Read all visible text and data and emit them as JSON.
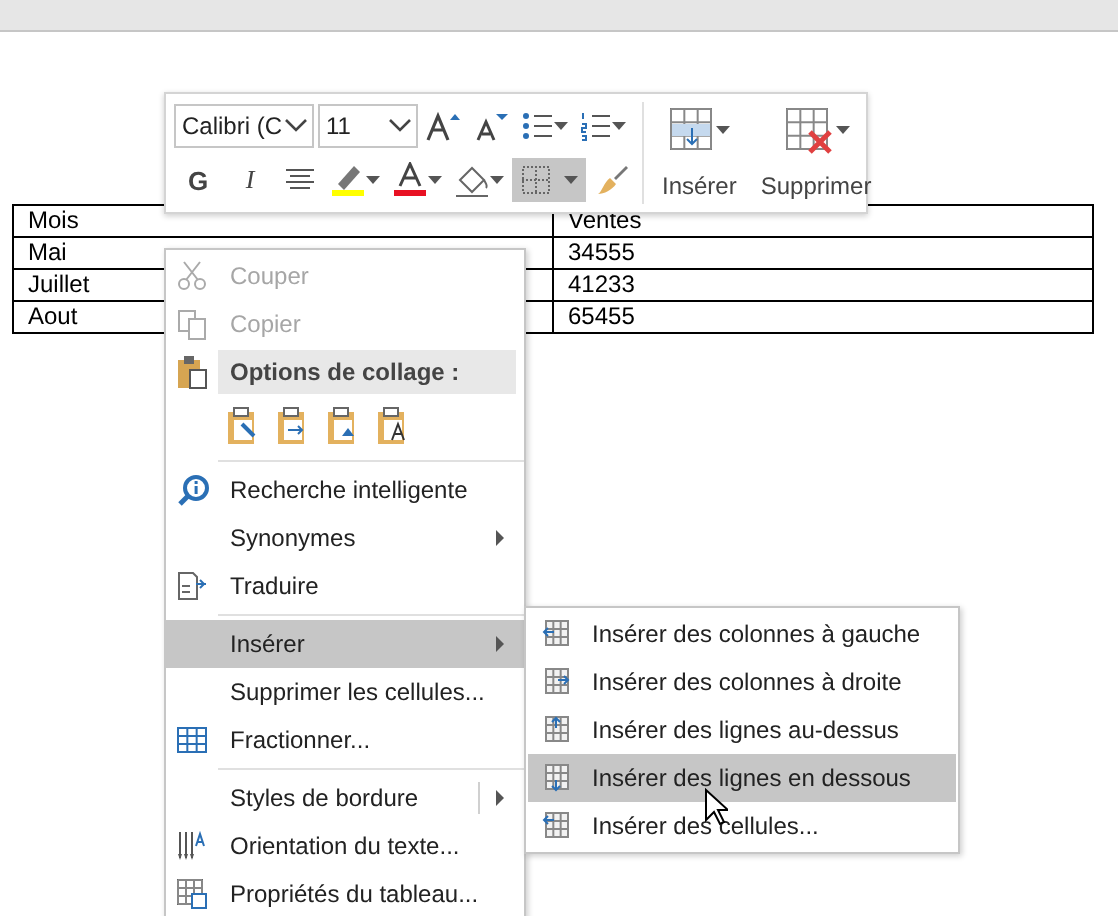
{
  "document": {
    "table": {
      "rows": [
        [
          "Mois",
          "Ventes"
        ],
        [
          "Mai",
          "34555"
        ],
        [
          "Juillet",
          "41233"
        ],
        [
          "Aout",
          "65455"
        ]
      ]
    }
  },
  "mini_toolbar": {
    "font": "Calibri (C",
    "size": "11",
    "bold": "G",
    "italic": "I",
    "borders_selected": true,
    "insert_label": "Insérer",
    "delete_label": "Supprimer"
  },
  "context_menu": {
    "items": [
      {
        "kind": "item",
        "label": "Couper",
        "disabled": true,
        "submenu": false,
        "selected": false
      },
      {
        "kind": "item",
        "label": "Copier",
        "disabled": true,
        "submenu": false,
        "selected": false
      },
      {
        "kind": "header",
        "label": "Options de collage :"
      },
      {
        "kind": "paste_options"
      },
      {
        "kind": "separator"
      },
      {
        "kind": "item",
        "label": "Recherche intelligente",
        "disabled": false,
        "submenu": false,
        "selected": false
      },
      {
        "kind": "item",
        "label": "Synonymes",
        "disabled": false,
        "submenu": true,
        "selected": false
      },
      {
        "kind": "item",
        "label": "Traduire",
        "disabled": false,
        "submenu": false,
        "selected": false
      },
      {
        "kind": "separator"
      },
      {
        "kind": "item",
        "label": "Insérer",
        "disabled": false,
        "submenu": true,
        "selected": true
      },
      {
        "kind": "item",
        "label": "Supprimer les cellules...",
        "disabled": false,
        "submenu": false,
        "selected": false
      },
      {
        "kind": "item",
        "label": "Fractionner...",
        "disabled": false,
        "submenu": false,
        "selected": false
      },
      {
        "kind": "separator"
      },
      {
        "kind": "item",
        "label": "Styles de bordure",
        "disabled": false,
        "submenu": true,
        "selected": false
      },
      {
        "kind": "item",
        "label": "Orientation du texte...",
        "disabled": false,
        "submenu": false,
        "selected": false
      },
      {
        "kind": "item",
        "label": "Propriétés du tableau...",
        "disabled": false,
        "submenu": false,
        "selected": false
      }
    ]
  },
  "insert_submenu": {
    "items": [
      {
        "label": "Insérer des colonnes à gauche",
        "selected": false
      },
      {
        "label": "Insérer des colonnes à droite",
        "selected": false
      },
      {
        "label": "Insérer des lignes au-dessus",
        "selected": false
      },
      {
        "label": "Insérer des lignes en dessous",
        "selected": true
      },
      {
        "label": "Insérer des cellules...",
        "selected": false
      }
    ]
  }
}
